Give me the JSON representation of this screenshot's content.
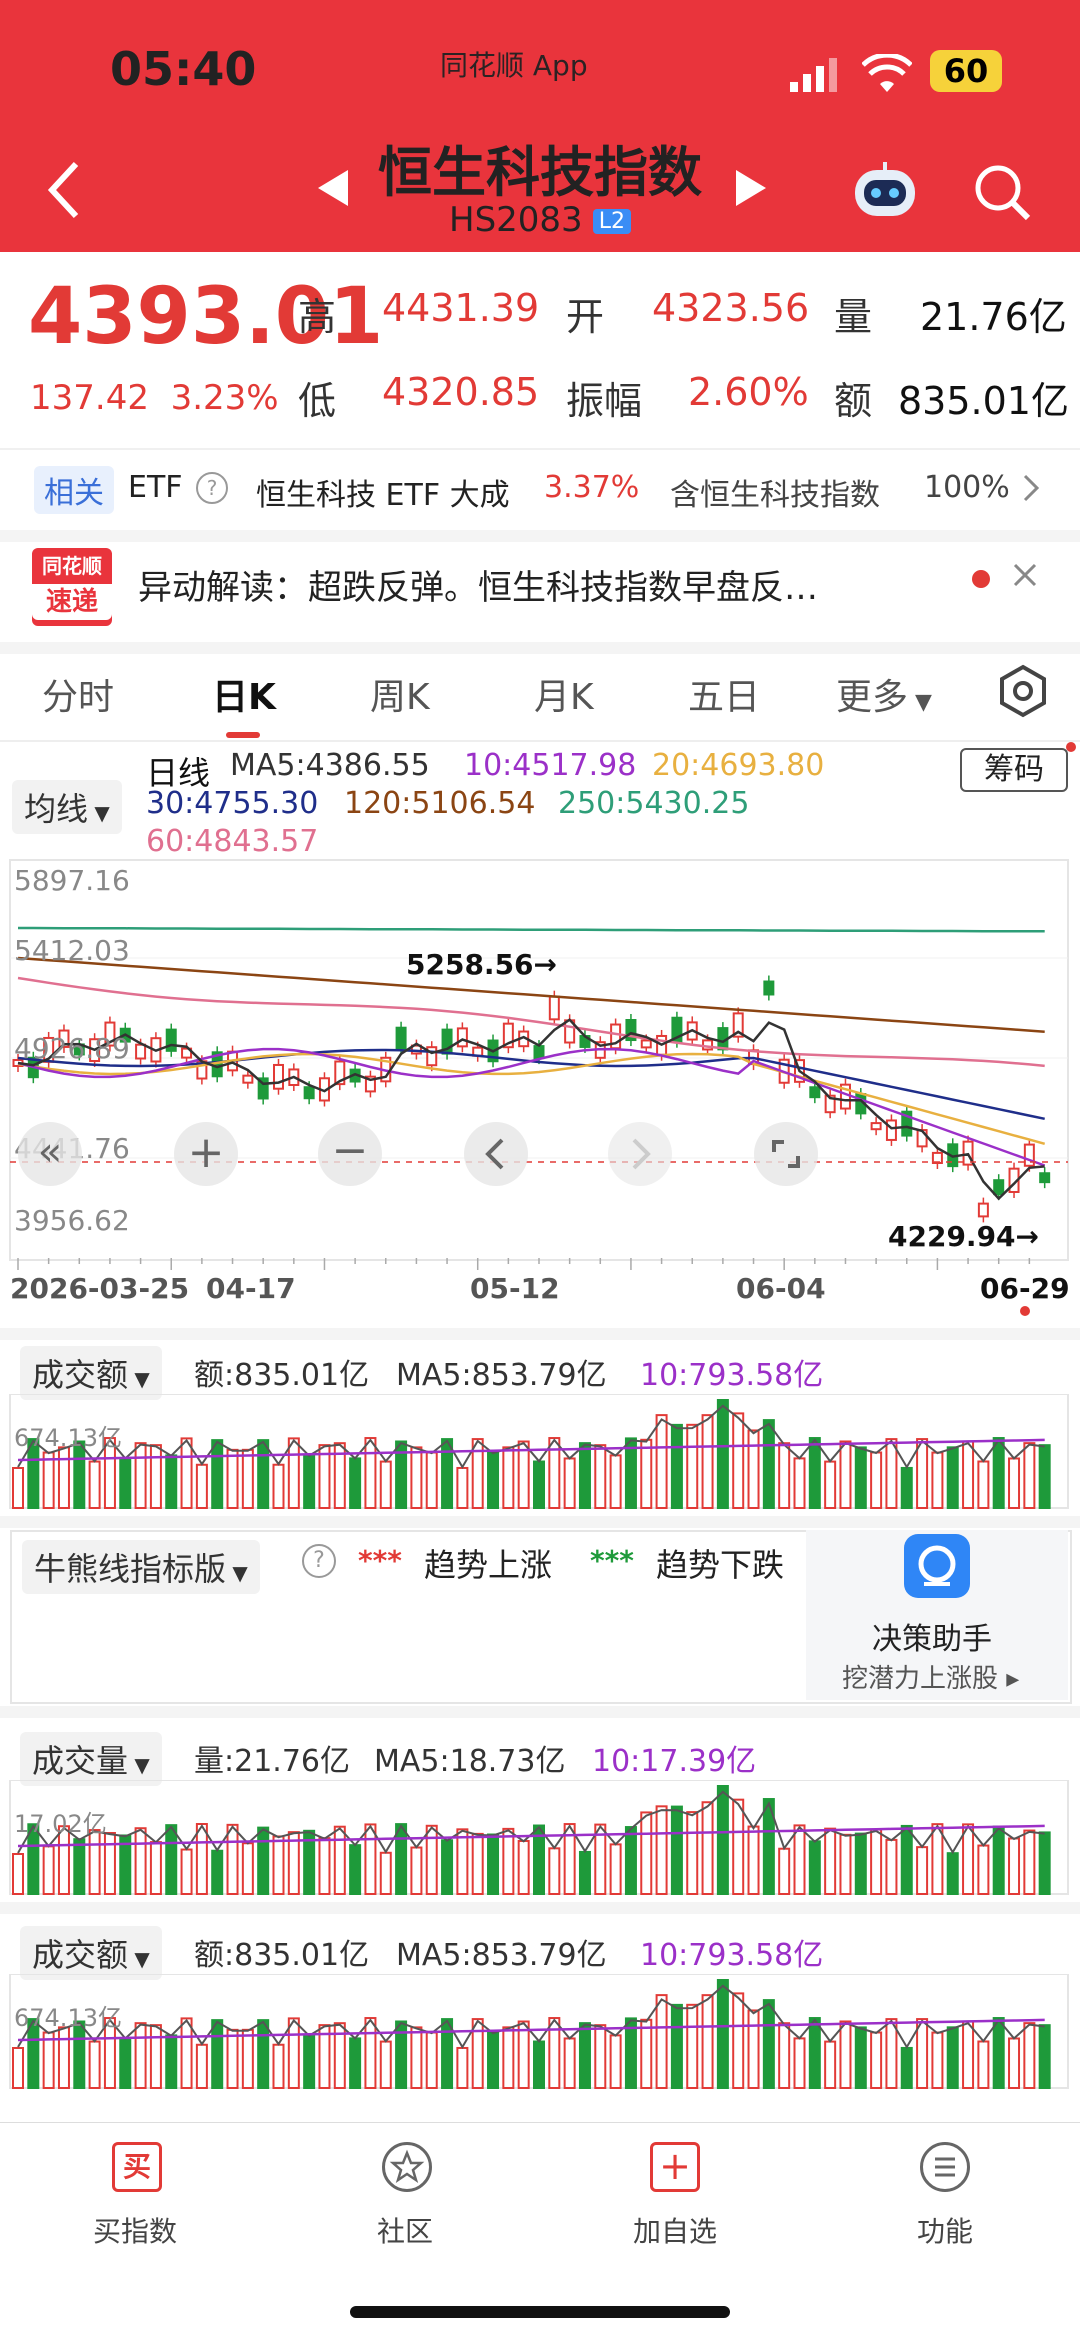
{
  "status_bar": {
    "time": "05:40",
    "app_label": "同花顺 App",
    "battery": "60"
  },
  "header": {
    "title": "恒生科技指数",
    "code": "HS2083",
    "level": "L2"
  },
  "quote": {
    "price": "4393.01",
    "change": "137.42",
    "change_pct": "3.23%",
    "high_label": "高",
    "high": "4431.39",
    "open_label": "开",
    "open": "4323.56",
    "vol_label": "量",
    "vol": "21.76亿",
    "low_label": "低",
    "low": "4320.85",
    "amp_label": "振幅",
    "amp": "2.60%",
    "amt_label": "额",
    "amt": "835.01亿"
  },
  "related": {
    "tag": "相关",
    "etf": "ETF",
    "etf_name": "恒生科技 ETF 大成",
    "etf_pct": "3.37%",
    "contains": "含恒生科技指数",
    "contains_pct": "100%"
  },
  "news": {
    "logo_top": "同花顺",
    "logo_bottom": "速递",
    "text": "异动解读：超跌反弹。恒生科技指数早盘反…"
  },
  "tabs": [
    "分时",
    "日K",
    "周K",
    "月K",
    "五日",
    "更多"
  ],
  "ma": {
    "selector": "均线",
    "label": "日线",
    "ma5": "MA5:4386.55",
    "ma10": "10:4517.98",
    "ma20": "20:4693.80",
    "ma30": "30:4755.30",
    "ma120": "120:5106.54",
    "ma250": "250:5430.25",
    "ma60": "60:4843.57",
    "chip_button": "筹码"
  },
  "kline": {
    "y_labels": [
      "5897.16",
      "5412.03",
      "4926.89",
      "4441.76",
      "3956.62"
    ],
    "high_marker": "5258.56→",
    "low_marker": "4229.94→",
    "dates": [
      "2026-03-25",
      "04-17",
      "05-12",
      "06-04",
      "06-29"
    ]
  },
  "amount1": {
    "selector": "成交额",
    "value": "额:835.01亿",
    "ma5": "MA5:853.79亿",
    "ma10": "10:793.58亿",
    "axis": "674.13亿"
  },
  "bullbear": {
    "selector": "牛熊线指标版",
    "up_mark": "***",
    "up": "趋势上涨",
    "down_mark": "***",
    "down": "趋势下跌",
    "assist_title": "决策助手",
    "assist_sub": "挖潜力上涨股"
  },
  "volume": {
    "selector": "成交量",
    "value": "量:21.76亿",
    "ma5": "MA5:18.73亿",
    "ma10": "10:17.39亿",
    "axis": "17.02亿"
  },
  "amount2": {
    "selector": "成交额",
    "value": "额:835.01亿",
    "ma5": "MA5:853.79亿",
    "ma10": "10:793.58亿",
    "axis": "674.13亿"
  },
  "nav": {
    "buy_icon": "买",
    "buy": "买指数",
    "community": "社区",
    "add_icon": "+",
    "add": "加自选",
    "func": "功能"
  },
  "colors": {
    "brand_red": "#e9343c",
    "up_red": "#e23a36",
    "down_green": "#1e9a3a",
    "ma5": "#333333",
    "ma10": "#9b30c8",
    "ma20": "#e8b040",
    "ma30": "#1f2e8a",
    "ma120": "#8b4513",
    "ma250": "#2e9e78",
    "ma60": "#e07090"
  }
}
